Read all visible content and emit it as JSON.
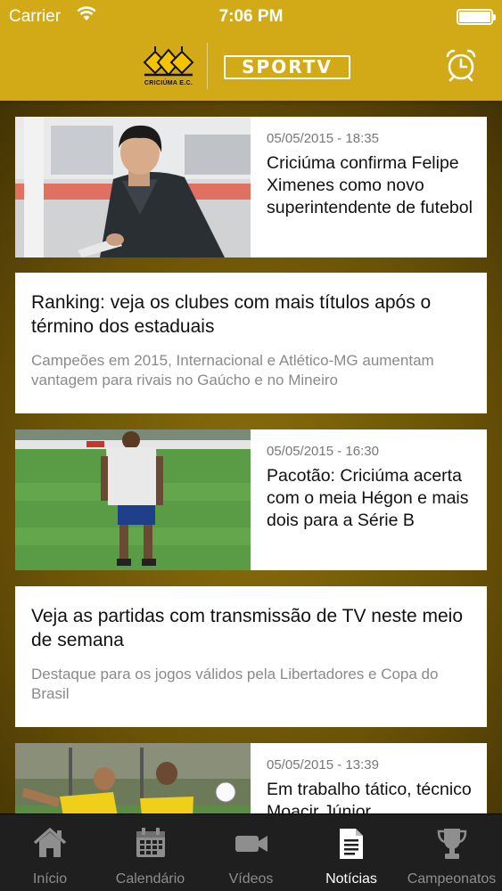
{
  "status_bar": {
    "carrier": "Carrier",
    "time": "7:06 PM"
  },
  "header": {
    "club_logo_text": "CRICIÚMA E.C.",
    "tv_logo_text": "SPORTV",
    "alarm_icon": "alarm-clock-icon",
    "background_color": "#d2a916"
  },
  "articles": [
    {
      "type": "image",
      "date": "05/05/2015 - 18:35",
      "title": "Criciúma confirma Felipe Ximenes como novo superintendente de futebol"
    },
    {
      "type": "text",
      "title": "Ranking: veja os clubes com mais títulos após o término dos estaduais",
      "description": "Campeões em 2015, Internacional e Atlético-MG aumentam vantagem para rivais no Gaúcho e no Mineiro"
    },
    {
      "type": "image",
      "date": "05/05/2015 - 16:30",
      "title": "Pacotão: Criciúma acerta com o meia Hégon e mais dois para a Série B"
    },
    {
      "type": "text",
      "title": "Veja as partidas com transmissão de TV neste meio de semana",
      "description": "Destaque para os jogos válidos pela Libertadores e Copa do Brasil"
    },
    {
      "type": "image",
      "date": "05/05/2015 - 13:39",
      "title": "Em trabalho tático, técnico Moacir Júnior"
    }
  ],
  "tabs": [
    {
      "label": "Início",
      "icon": "home-icon",
      "active": false
    },
    {
      "label": "Calendário",
      "icon": "calendar-icon",
      "active": false
    },
    {
      "label": "Vídeos",
      "icon": "video-camera-icon",
      "active": false
    },
    {
      "label": "Notícias",
      "icon": "document-icon",
      "active": true
    },
    {
      "label": "Campeonatos",
      "icon": "trophy-icon",
      "active": false
    }
  ]
}
